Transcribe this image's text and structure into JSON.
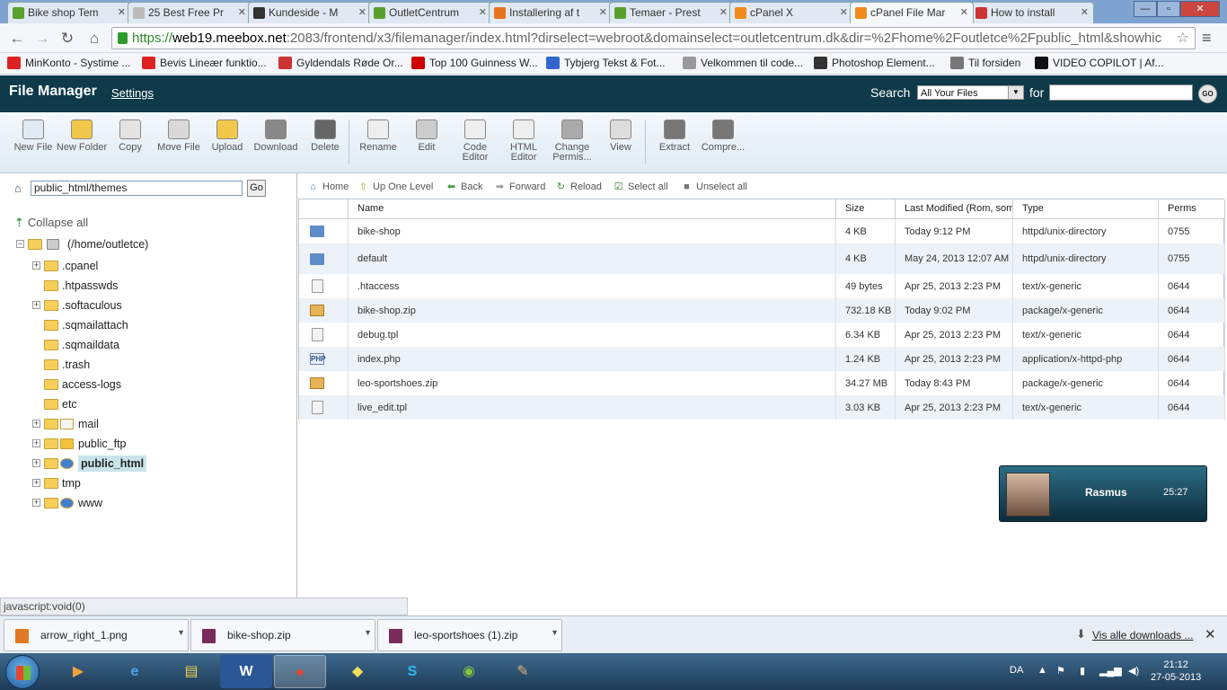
{
  "browser": {
    "tabs": [
      {
        "label": "Bike shop Tem",
        "icon_color": "#5aa02c"
      },
      {
        "label": "25 Best Free Pr",
        "icon_color": "#bbbbbb"
      },
      {
        "label": "Kundeside - M",
        "icon_color": "#333333"
      },
      {
        "label": "OutletCentrum",
        "icon_color": "#5aa02c"
      },
      {
        "label": "Installering af t",
        "icon_color": "#e8741e"
      },
      {
        "label": "Temaer - Prest",
        "icon_color": "#5aa02c"
      },
      {
        "label": "cPanel X",
        "icon_color": "#f08c1e"
      },
      {
        "label": "cPanel File Mar",
        "icon_color": "#f08c1e"
      },
      {
        "label": "How to install",
        "icon_color": "#cc3333"
      }
    ],
    "active_tab": 7,
    "url_scheme": "https://",
    "url_host": "web19.meebox.net",
    "url_path": ":2083/frontend/x3/filemanager/index.html?dirselect=webroot&domainselect=outletcentrum.dk&dir=%2Fhome%2Foutletce%2Fpublic_html&showhic",
    "bookmarks": [
      {
        "label": "MinKonto - Systime ...",
        "color": "#d22"
      },
      {
        "label": "Bevis Lineær funktio...",
        "color": "#d22"
      },
      {
        "label": "Gyldendals Røde Or...",
        "color": "#c33"
      },
      {
        "label": "Top 100 Guinness W...",
        "color": "#c00"
      },
      {
        "label": "Tybjerg Tekst & Fot...",
        "color": "#3366cc"
      },
      {
        "label": "Velkommen til code...",
        "color": "#999"
      },
      {
        "label": "Photoshop Element...",
        "color": "#333"
      },
      {
        "label": "Til forsiden",
        "color": "#777"
      },
      {
        "label": "VIDEO COPILOT | Af...",
        "color": "#111"
      }
    ]
  },
  "header": {
    "title": "File Manager",
    "settings": "Settings",
    "search_label": "Search",
    "search_scope": "All Your Files",
    "for_label": "for",
    "go": "GO"
  },
  "toolbar": [
    {
      "label": "New File",
      "icon": "new-file-icon"
    },
    {
      "label": "New Folder",
      "icon": "new-folder-icon"
    },
    {
      "label": "Copy",
      "icon": "copy-icon"
    },
    {
      "label": "Move File",
      "icon": "move-file-icon"
    },
    {
      "label": "Upload",
      "icon": "upload-icon"
    },
    {
      "label": "Download",
      "icon": "download-icon"
    },
    {
      "label": "Delete",
      "icon": "delete-icon"
    },
    {
      "label": "Rename",
      "icon": "rename-icon"
    },
    {
      "label": "Edit",
      "icon": "edit-icon"
    },
    {
      "label": "Code Editor",
      "icon": "code-editor-icon"
    },
    {
      "label": "HTML Editor",
      "icon": "html-editor-icon"
    },
    {
      "label": "Change Permis...",
      "icon": "permissions-icon"
    },
    {
      "label": "View",
      "icon": "view-icon"
    },
    {
      "label": "Extract",
      "icon": "extract-icon"
    },
    {
      "label": "Compre...",
      "icon": "compress-icon"
    }
  ],
  "tree": {
    "path_value": "public_html/themes",
    "go": "Go",
    "collapse_all": "Collapse all",
    "root": "(/home/outletce)",
    "nodes": [
      {
        "label": ".cpanel",
        "expandable": true,
        "kind": "folder"
      },
      {
        "label": ".htpasswds",
        "expandable": false,
        "kind": "folder"
      },
      {
        "label": ".softaculous",
        "expandable": true,
        "kind": "folder"
      },
      {
        "label": ".sqmailattach",
        "expandable": false,
        "kind": "folder"
      },
      {
        "label": ".sqmaildata",
        "expandable": false,
        "kind": "folder"
      },
      {
        "label": ".trash",
        "expandable": false,
        "kind": "folder"
      },
      {
        "label": "access-logs",
        "expandable": false,
        "kind": "folder"
      },
      {
        "label": "etc",
        "expandable": false,
        "kind": "folder"
      },
      {
        "label": "mail",
        "expandable": true,
        "kind": "mail"
      },
      {
        "label": "public_ftp",
        "expandable": true,
        "kind": "ftp"
      },
      {
        "label": "public_html",
        "expandable": true,
        "kind": "web",
        "selected": true
      },
      {
        "label": "tmp",
        "expandable": true,
        "kind": "folder"
      },
      {
        "label": "www",
        "expandable": true,
        "kind": "web"
      }
    ]
  },
  "actions": [
    {
      "label": "Home",
      "icon": "home-icon"
    },
    {
      "label": "Up One Level",
      "icon": "up-level-icon"
    },
    {
      "label": "Back",
      "icon": "back-arrow-icon"
    },
    {
      "label": "Forward",
      "icon": "forward-arrow-icon"
    },
    {
      "label": "Reload",
      "icon": "reload-icon"
    },
    {
      "label": "Select all",
      "icon": "checkbox-checked-icon"
    },
    {
      "label": "Unselect all",
      "icon": "checkbox-empty-icon"
    }
  ],
  "columns": [
    "Name",
    "Size",
    "Last Modified (Rom, somr",
    "Type",
    "Perms"
  ],
  "files": [
    {
      "name": "bike-shop",
      "size": "4 KB",
      "modified": "Today 9:12 PM",
      "type": "httpd/unix-directory",
      "perms": "0755",
      "kind": "folder"
    },
    {
      "name": "default",
      "size": "4 KB",
      "modified": "May 24, 2013 12:07 AM",
      "type": "httpd/unix-directory",
      "perms": "0755",
      "kind": "folder"
    },
    {
      "name": ".htaccess",
      "size": "49 bytes",
      "modified": "Apr 25, 2013 2:23 PM",
      "type": "text/x-generic",
      "perms": "0644",
      "kind": "doc"
    },
    {
      "name": "bike-shop.zip",
      "size": "732.18 KB",
      "modified": "Today 9:02 PM",
      "type": "package/x-generic",
      "perms": "0644",
      "kind": "zip"
    },
    {
      "name": "debug.tpl",
      "size": "6.34 KB",
      "modified": "Apr 25, 2013 2:23 PM",
      "type": "text/x-generic",
      "perms": "0644",
      "kind": "doc"
    },
    {
      "name": "index.php",
      "size": "1.24 KB",
      "modified": "Apr 25, 2013 2:23 PM",
      "type": "application/x-httpd-php",
      "perms": "0644",
      "kind": "php"
    },
    {
      "name": "leo-sportshoes.zip",
      "size": "34.27 MB",
      "modified": "Today 8:43 PM",
      "type": "package/x-generic",
      "perms": "0644",
      "kind": "zip"
    },
    {
      "name": "live_edit.tpl",
      "size": "3.03 KB",
      "modified": "Apr 25, 2013 2:23 PM",
      "type": "text/x-generic",
      "perms": "0644",
      "kind": "doc"
    }
  ],
  "php_label": "PHP",
  "chat": {
    "name": "Rasmus",
    "time": "25:27"
  },
  "status_text": "javascript:void(0)",
  "downloads": {
    "items": [
      {
        "label": "arrow_right_1.png",
        "color": "#e07a22"
      },
      {
        "label": "bike-shop.zip",
        "color": "#7a2a5a"
      },
      {
        "label": "leo-sportshoes (1).zip",
        "color": "#7a2a5a"
      }
    ],
    "show_all": "Vis alle downloads ..."
  },
  "taskbar": {
    "language": "DA",
    "time": "21:12",
    "date": "27-05-2013"
  }
}
